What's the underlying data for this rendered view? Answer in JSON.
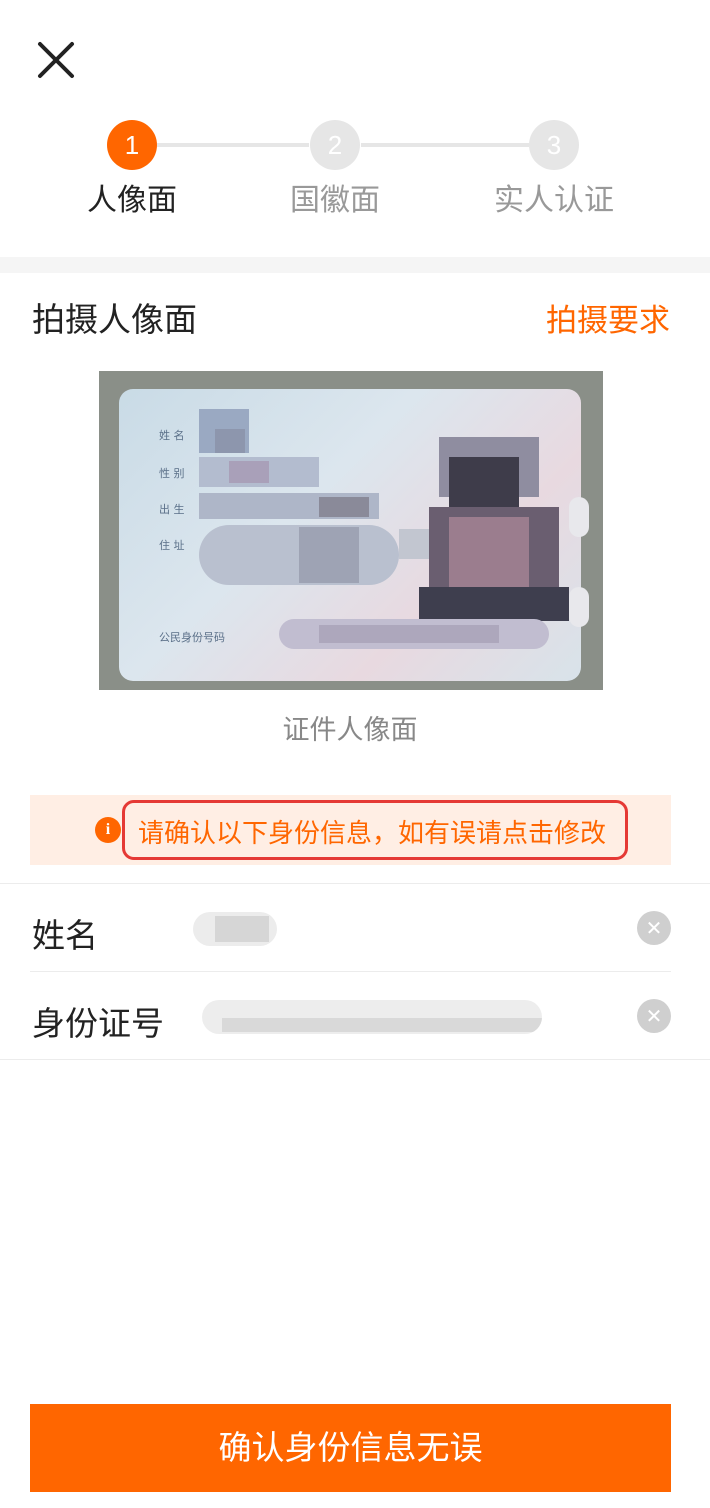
{
  "header": {
    "close_icon": "close-icon"
  },
  "stepper": {
    "steps": [
      {
        "number": "1",
        "label": "人像面",
        "state": "active"
      },
      {
        "number": "2",
        "label": "国徽面",
        "state": "todo"
      },
      {
        "number": "3",
        "label": "实人认证",
        "state": "todo"
      }
    ],
    "active_color": "#ff6600"
  },
  "capture": {
    "title": "拍摄人像面",
    "requirements_link": "拍摄要求",
    "card_caption": "证件人像面",
    "card_labels": [
      "姓 名",
      "性 别",
      "出 生",
      "住 址",
      "公民身份号码"
    ]
  },
  "notice": {
    "icon": "info-icon",
    "text": "请确认以下身份信息，如有误请点击修改"
  },
  "form": {
    "name_label": "姓名",
    "id_label": "身份证号",
    "clear_icon": "clear-icon"
  },
  "footer": {
    "confirm_label": "确认身份信息无误"
  },
  "colors": {
    "accent": "#ff6600",
    "highlight_border": "#e53935"
  }
}
